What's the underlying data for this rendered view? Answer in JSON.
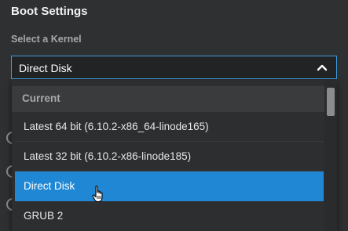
{
  "settings": {
    "title": "Boot Settings",
    "kernel_label": "Select a Kernel"
  },
  "kernel_select": {
    "value": "Direct Disk",
    "expanded": true
  },
  "dropdown": {
    "group_header": "Current",
    "options": [
      {
        "label": "Latest 64 bit (6.10.2-x86_64-linode165)",
        "selected": false
      },
      {
        "label": "Latest 32 bit (6.10.2-x86-linode185)",
        "selected": false
      },
      {
        "label": "Direct Disk",
        "selected": true
      },
      {
        "label": "GRUB 2",
        "selected": false
      }
    ]
  },
  "colors": {
    "accent": "#3d9ee0",
    "selected_bg": "#1f87d3",
    "background": "#2f3032"
  },
  "icons": {
    "chevron": "chevron-up-icon",
    "cursor": "hand-pointer-cursor"
  }
}
